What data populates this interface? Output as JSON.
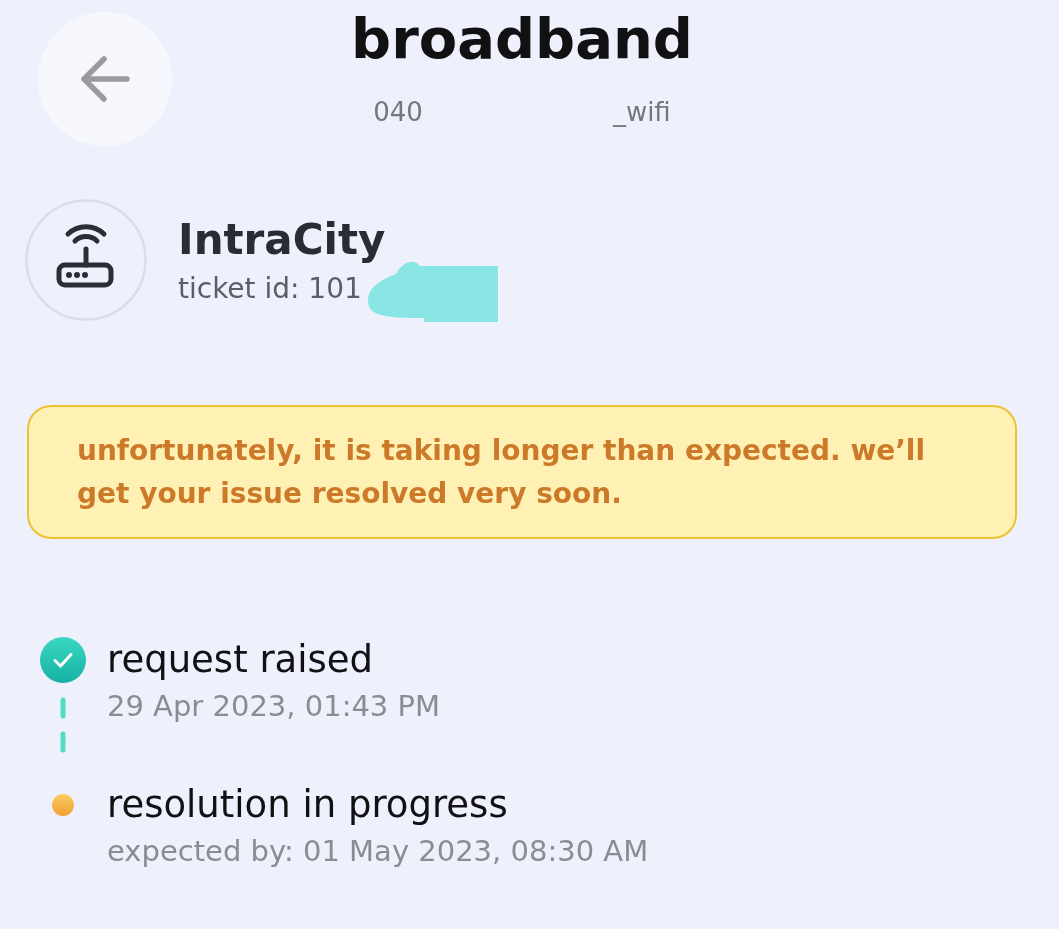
{
  "header": {
    "title": "broadband",
    "subtitle": {
      "start": "040",
      "end": "_wifi"
    }
  },
  "ticket": {
    "name": "IntraCity",
    "ticket_id": "ticket id: 101"
  },
  "notice": {
    "text": "unfortunately, it is taking longer than expected. we’ll get your issue resolved very soon."
  },
  "timeline": [
    {
      "kind": "done",
      "title": "request raised",
      "time": "29 Apr 2023, 01:43 PM"
    },
    {
      "kind": "in_progress",
      "title": "resolution in progress",
      "time": "expected by: 01 May 2023, 08:30 AM"
    }
  ]
}
